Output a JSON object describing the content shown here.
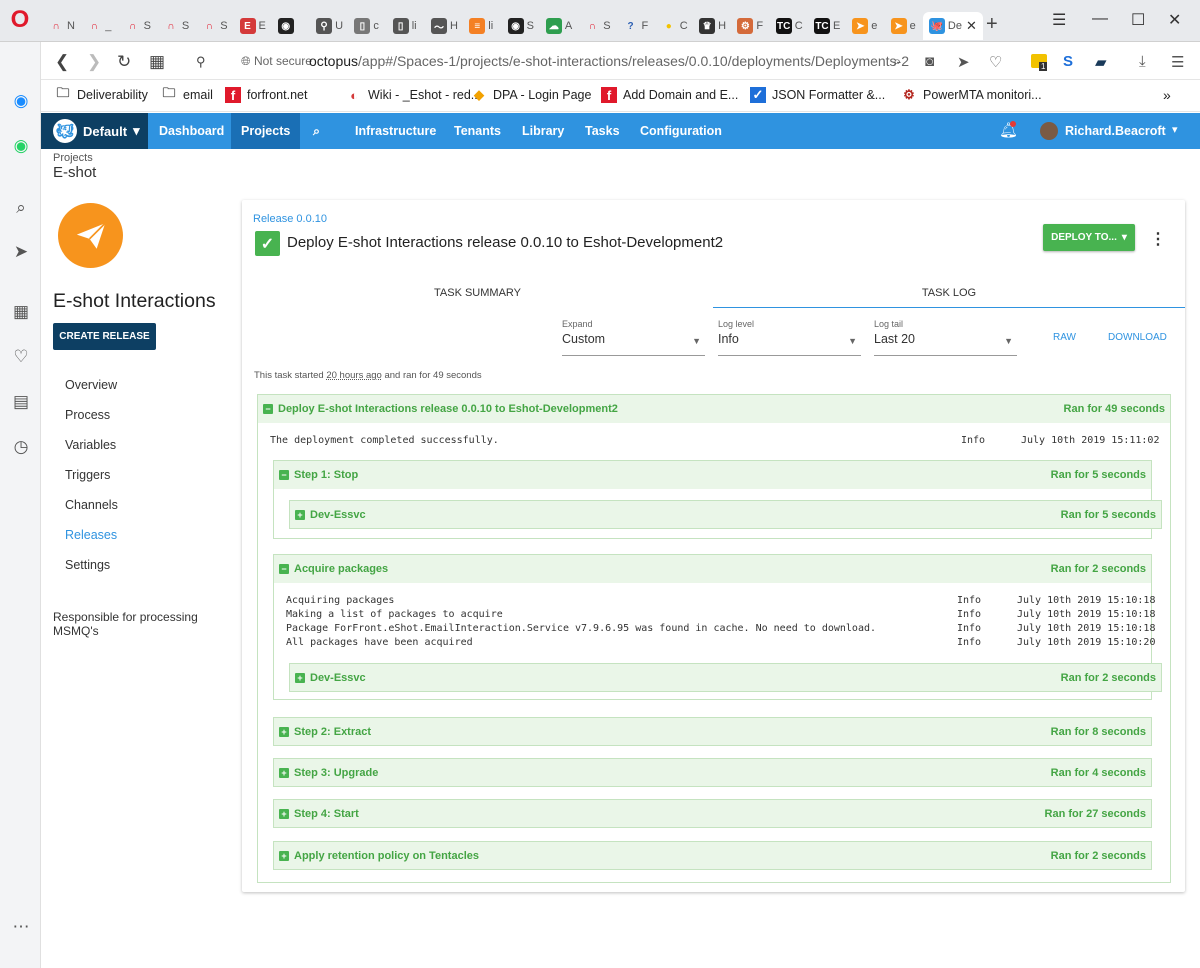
{
  "browser": {
    "tabs": [
      {
        "icon": "opera-icon",
        "label": "N",
        "color": "#e0192b"
      },
      {
        "icon": "opera-icon",
        "label": "_",
        "color": "#e0192b"
      },
      {
        "icon": "opera-icon",
        "label": "S",
        "color": "#e0192b"
      },
      {
        "icon": "opera-icon",
        "label": "S",
        "color": "#e0192b"
      },
      {
        "icon": "opera-icon",
        "label": "S",
        "color": "#e0192b"
      },
      {
        "icon": "book-icon",
        "label": "E",
        "color": "#d43a3a"
      },
      {
        "icon": "github-icon",
        "label": "",
        "color": "#222"
      },
      {
        "icon": "key-icon",
        "label": "U",
        "color": "#555"
      },
      {
        "icon": "doc-icon",
        "label": "c",
        "color": "#777"
      },
      {
        "icon": "doc-icon",
        "label": "li",
        "color": "#555"
      },
      {
        "icon": "wave-icon",
        "label": "H",
        "color": "#555"
      },
      {
        "icon": "stack-icon",
        "label": "li",
        "color": "#f48024"
      },
      {
        "icon": "github-icon",
        "label": "S",
        "color": "#222"
      },
      {
        "icon": "cloud-icon",
        "label": "A",
        "color": "#2e9e4f"
      },
      {
        "icon": "opera-icon",
        "label": "S",
        "color": "#e0192b"
      },
      {
        "icon": "question-icon",
        "label": "F",
        "color": "#2b5fb3"
      },
      {
        "icon": "bulb-icon",
        "label": "C",
        "color": "#f2c200"
      },
      {
        "icon": "crown-icon",
        "label": "H",
        "color": "#333"
      },
      {
        "icon": "gears-icon",
        "label": "F",
        "color": "#d46a3a"
      },
      {
        "icon": "teamcity-icon",
        "label": "C",
        "color": "#111"
      },
      {
        "icon": "teamcity-icon",
        "label": "E",
        "color": "#111"
      },
      {
        "icon": "plane-icon",
        "label": "e",
        "color": "#f7941d"
      },
      {
        "icon": "plane-icon",
        "label": "e",
        "color": "#f7941d"
      },
      {
        "icon": "octopus-icon",
        "label": "De",
        "color": "#2f93e0"
      }
    ],
    "security_label": "Not secure",
    "url_host": "octopus",
    "url_path": "/app#/Spaces-1/projects/e-shot-interactions/releases/0.0.10/deployments/Deployments-2",
    "ext_badge": "1",
    "bookmarks": [
      {
        "icon": "folder-icon",
        "label": "Deliverability",
        "color": "#555"
      },
      {
        "icon": "folder-icon",
        "label": "email",
        "color": "#555"
      },
      {
        "icon": "forfront-icon",
        "label": "forfront.net",
        "color": "#e0192b"
      },
      {
        "icon": "wiki-icon",
        "label": "Wiki - _Eshot - red...",
        "color": "#d43a3a"
      },
      {
        "icon": "dpa-icon",
        "label": "DPA - Login Page",
        "color": "#f2a100"
      },
      {
        "icon": "forfront-icon",
        "label": "Add Domain and E...",
        "color": "#e0192b"
      },
      {
        "icon": "check-icon",
        "label": "JSON Formatter &...",
        "color": "#1e6fd9"
      },
      {
        "icon": "gear-icon",
        "label": "PowerMTA monitori...",
        "color": "#b3261e"
      }
    ]
  },
  "app": {
    "space": "Default",
    "nav": [
      "Dashboard",
      "Projects",
      "Infrastructure",
      "Tenants",
      "Library",
      "Tasks",
      "Configuration"
    ],
    "user": "Richard.Beacroft"
  },
  "breadcrumb": {
    "parent": "Projects",
    "title": "E-shot"
  },
  "project": {
    "name": "E-shot Interactions",
    "create_release": "CREATE RELEASE",
    "menu": [
      "Overview",
      "Process",
      "Variables",
      "Triggers",
      "Channels",
      "Releases",
      "Settings"
    ],
    "selected": "Releases",
    "description": "Responsible for processing MSMQ's"
  },
  "task": {
    "release_link": "Release 0.0.10",
    "title": "Deploy E-shot Interactions release 0.0.10 to Eshot-Development2",
    "deploy_button": "DEPLOY TO...",
    "tabs": [
      "TASK SUMMARY",
      "TASK LOG"
    ],
    "active_tab": "TASK LOG",
    "filters": [
      {
        "label": "Expand",
        "value": "Custom"
      },
      {
        "label": "Log level",
        "value": "Info"
      },
      {
        "label": "Log tail",
        "value": "Last 20"
      }
    ],
    "raw": "RAW",
    "download": "DOWNLOAD",
    "started_prefix": "This task started ",
    "started_ago": "20 hours ago",
    "started_suffix": " and ran for 49 seconds"
  },
  "log": {
    "root": {
      "title": "Deploy E-shot Interactions release 0.0.10 to Eshot-Development2",
      "duration": "Ran for 49 seconds"
    },
    "root_line": {
      "text": "The deployment completed successfully.",
      "level": "Info",
      "time": "July 10th 2019 15:11:02"
    },
    "step1": {
      "title": "Step 1: Stop",
      "duration": "Ran for 5 seconds"
    },
    "step1_child": {
      "title": "Dev-Essvc",
      "duration": "Ran for 5 seconds"
    },
    "acquire": {
      "title": "Acquire packages",
      "duration": "Ran for 2 seconds"
    },
    "acquire_lines": [
      {
        "text": "Acquiring packages",
        "level": "Info",
        "time": "July 10th 2019 15:10:18"
      },
      {
        "text": "Making a list of packages to acquire",
        "level": "Info",
        "time": "July 10th 2019 15:10:18"
      },
      {
        "text": "Package ForFront.eShot.EmailInteraction.Service v7.9.6.95 was found in cache. No need to download.",
        "level": "Info",
        "time": "July 10th 2019 15:10:18"
      },
      {
        "text": "All packages have been acquired",
        "level": "Info",
        "time": "July 10th 2019 15:10:20"
      }
    ],
    "acquire_child": {
      "title": "Dev-Essvc",
      "duration": "Ran for 2 seconds"
    },
    "collapsed": [
      {
        "title": "Step 2: Extract",
        "duration": "Ran for 8 seconds"
      },
      {
        "title": "Step 3: Upgrade",
        "duration": "Ran for 4 seconds"
      },
      {
        "title": "Step 4: Start",
        "duration": "Ran for 27 seconds"
      },
      {
        "title": "Apply retention policy on Tentacles",
        "duration": "Ran for 2 seconds"
      }
    ]
  },
  "colors": {
    "success": "#48b350",
    "nav": "#2f93e0",
    "navdark": "#0d3f63",
    "project_logo": "#f7941d"
  }
}
